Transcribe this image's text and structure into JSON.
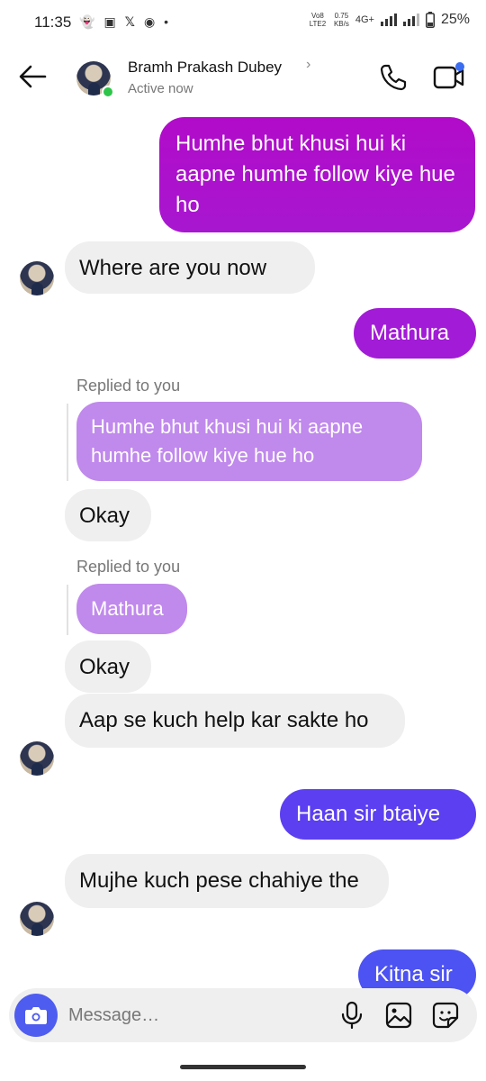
{
  "status_bar": {
    "time": "11:35",
    "network_top": "Vo8 LTE2",
    "speed_value": "0.75",
    "speed_unit": "KB/s",
    "net_type": "4G+",
    "battery": "25%"
  },
  "header": {
    "contact_name": "Bramh Prakash Dubey",
    "status": "Active now",
    "chevron": "›"
  },
  "messages": [
    {
      "side": "outgoing",
      "text": "Humhe bhut khusi hui ki aapne humhe follow kiye hue ho",
      "color": "#b30fc8"
    },
    {
      "side": "incoming",
      "text": "Where are you now"
    },
    {
      "side": "outgoing",
      "text": "Mathura",
      "color": "#a21bd6"
    },
    {
      "reply_label": "Replied to you",
      "quoted": "Humhe bhut khusi hui ki aapne humhe follow kiye hue ho"
    },
    {
      "side": "incoming",
      "text": "Okay"
    },
    {
      "reply_label": "Replied to you",
      "quoted": "Mathura"
    },
    {
      "side": "incoming",
      "text": "Okay"
    },
    {
      "side": "incoming",
      "text": "Aap se kuch help kar sakte ho"
    },
    {
      "side": "outgoing",
      "text": "Haan sir btaiye",
      "color": "#5b3ff1"
    },
    {
      "side": "incoming",
      "text": "Mujhe kuch pese chahiye the"
    },
    {
      "side": "outgoing",
      "text": "Kitna sir",
      "color": "#4d52f2"
    }
  ],
  "composer": {
    "placeholder": "Message…"
  },
  "colors": {
    "accent": "#4f5cf0",
    "incoming_bg": "#efefef",
    "online": "#2ec44a"
  },
  "icons": [
    "back-arrow-icon",
    "phone-icon",
    "video-icon",
    "camera-icon",
    "mic-icon",
    "gallery-icon",
    "sticker-icon"
  ]
}
